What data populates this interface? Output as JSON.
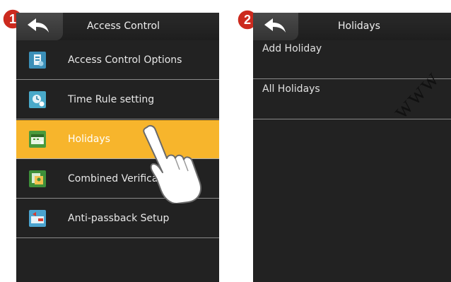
{
  "steps": {
    "first": "1",
    "second": "2"
  },
  "screen1": {
    "title": "Access Control",
    "back_icon": "back-arrow-icon",
    "items": [
      {
        "label": "Access Control Options",
        "icon": "access-control-options-icon"
      },
      {
        "label": "Time Rule setting",
        "icon": "time-rule-icon"
      },
      {
        "label": "Holidays",
        "icon": "holidays-icon",
        "selected": true
      },
      {
        "label": "Combined Verification",
        "icon": "combined-verification-icon"
      },
      {
        "label": "Anti-passback Setup",
        "icon": "anti-passback-icon"
      }
    ]
  },
  "screen2": {
    "title": "Holidays",
    "back_icon": "back-arrow-icon",
    "items": [
      {
        "label": "Add Holiday"
      },
      {
        "label": "All Holidays"
      }
    ]
  },
  "watermark": "www",
  "colors": {
    "screen_background": "#222222",
    "selected_row": "#f7b52c",
    "badge": "#cc2a1e",
    "divider": "#8a8a8a"
  }
}
